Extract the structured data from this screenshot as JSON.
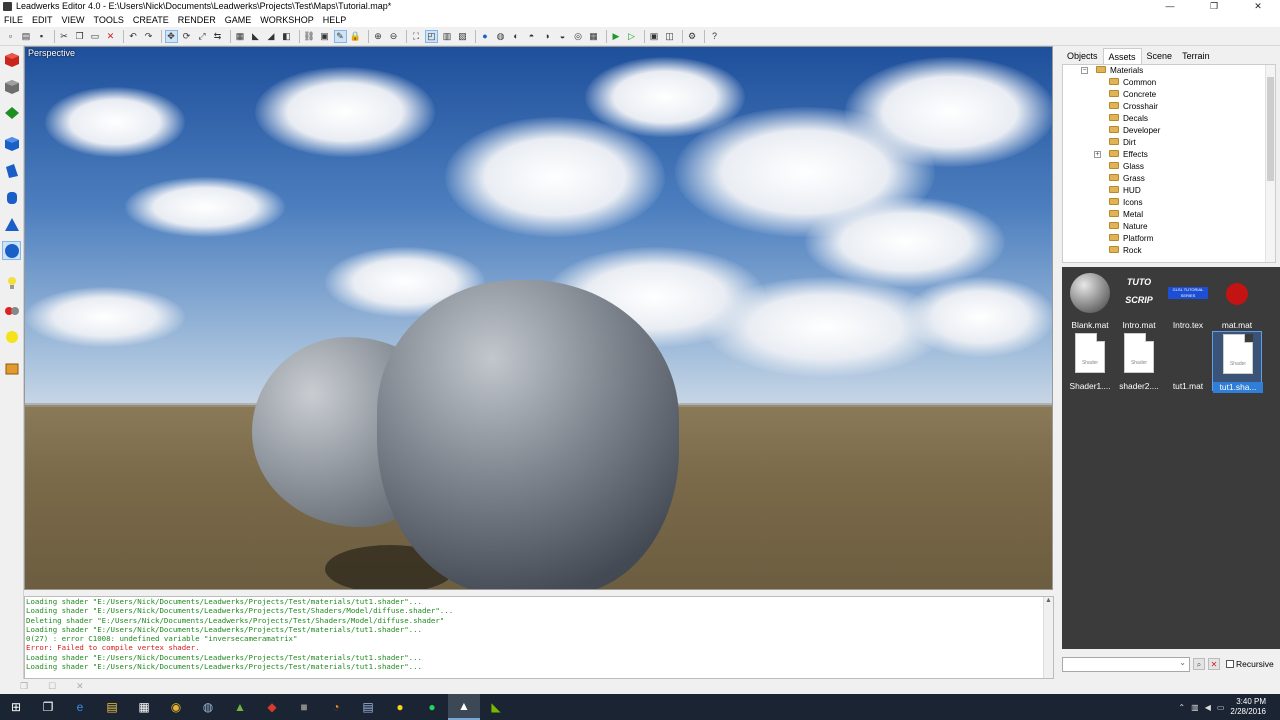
{
  "window": {
    "title": "Leadwerks Editor 4.0 - E:\\Users\\Nick\\Documents\\Leadwerks\\Projects\\Test\\Maps\\Tutorial.map*",
    "minimize": "—",
    "maximize": "❐",
    "close": "✕"
  },
  "menu": [
    "FILE",
    "EDIT",
    "VIEW",
    "TOOLS",
    "CREATE",
    "RENDER",
    "GAME",
    "WORKSHOP",
    "HELP"
  ],
  "viewport": {
    "label": "Perspective"
  },
  "console": {
    "lines": [
      {
        "text": "Loading shader \"E:/Users/Nick/Documents/Leadwerks/Projects/Test/materials/tut1.shader\"...",
        "color": "green"
      },
      {
        "text": "Loading shader \"E:/Users/Nick/Documents/Leadwerks/Projects/Test/Shaders/Model/diffuse.shader\"...",
        "color": "green"
      },
      {
        "text": "Deleting shader \"E:/Users/Nick/Documents/Leadwerks/Projects/Test/Shaders/Model/diffuse.shader\"",
        "color": "green"
      },
      {
        "text": "Loading shader \"E:/Users/Nick/Documents/Leadwerks/Projects/Test/materials/tut1.shader\"...",
        "color": "green"
      },
      {
        "text": "0(27) : error C1008: undefined variable \"inversecameramatrix\"",
        "color": "green"
      },
      {
        "text": "Error: Failed to compile vertex shader.",
        "color": "red"
      },
      {
        "text": "Loading shader \"E:/Users/Nick/Documents/Leadwerks/Projects/Test/materials/tut1.shader\"...",
        "color": "green"
      },
      {
        "text": "Loading shader \"E:/Users/Nick/Documents/Leadwerks/Projects/Test/materials/tut1.shader\"...",
        "color": "green"
      }
    ]
  },
  "panel": {
    "tabs": [
      "Objects",
      "Assets",
      "Scene",
      "Terrain"
    ],
    "active_tab": "Assets",
    "tree": {
      "root": "Materials",
      "items": [
        "Common",
        "Concrete",
        "Crosshair",
        "Decals",
        "Developer",
        "Dirt",
        "Effects",
        "Glass",
        "Grass",
        "HUD",
        "Icons",
        "Metal",
        "Nature",
        "Platform",
        "Rock"
      ]
    },
    "assets": [
      {
        "label": "Blank.mat",
        "kind": "sphere"
      },
      {
        "label": "Intro.mat",
        "kind": "intro"
      },
      {
        "label": "Intro.tex",
        "kind": "tex"
      },
      {
        "label": "mat.mat",
        "kind": "red"
      },
      {
        "label": "Shader1....",
        "kind": "shader"
      },
      {
        "label": "shader2....",
        "kind": "shader"
      },
      {
        "label": "tut1.mat",
        "kind": "blank"
      },
      {
        "label": "tut1.sha...",
        "kind": "shader",
        "selected": true
      }
    ],
    "shader_thumb_text": "Shader",
    "intro_thumb_text": "TUTO SCRIP",
    "tex_thumb_text": "GLSL TUTORIAL SERIES",
    "search": {
      "placeholder": "",
      "recursive_label": "Recursive",
      "recursive_checked": false
    }
  },
  "statusbar": {
    "items": [
      "❐",
      "☐",
      "✕"
    ]
  },
  "taskbar": {
    "clock_time": "3:40 PM",
    "clock_date": "2/28/2016"
  }
}
